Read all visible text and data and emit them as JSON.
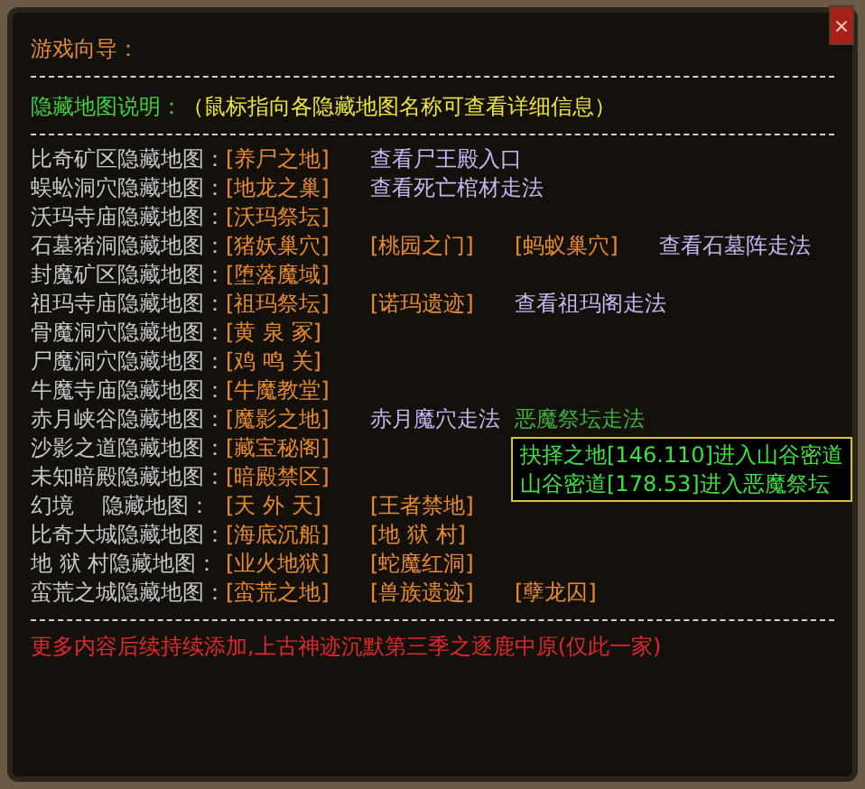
{
  "title": "游戏向导：",
  "close_button": "×",
  "legend": {
    "label": "隐藏地图说明：",
    "hint": "（鼠标指向各隐藏地图名称可查看详细信息）"
  },
  "rows": [
    {
      "label": "比奇矿区隐藏地图：",
      "items": [
        {
          "kind": "map",
          "text": "[养尸之地]",
          "hovered": false
        },
        {
          "kind": "guide",
          "text": "查看尸王殿入口",
          "hovered": false
        }
      ]
    },
    {
      "label": "蜈蚣洞穴隐藏地图：",
      "items": [
        {
          "kind": "map",
          "text": "[地龙之巢]",
          "hovered": false
        },
        {
          "kind": "guide",
          "text": "查看死亡棺材走法",
          "hovered": false
        }
      ]
    },
    {
      "label": "沃玛寺庙隐藏地图：",
      "items": [
        {
          "kind": "map",
          "text": "[沃玛祭坛]",
          "hovered": false
        }
      ]
    },
    {
      "label": "石墓猪洞隐藏地图：",
      "items": [
        {
          "kind": "map",
          "text": "[猪妖巢穴]",
          "hovered": false
        },
        {
          "kind": "map",
          "text": "[桃园之门]",
          "hovered": false
        },
        {
          "kind": "map",
          "text": "[蚂蚁巢穴]",
          "hovered": false
        },
        {
          "kind": "guide",
          "text": "查看石墓阵走法",
          "hovered": false
        }
      ]
    },
    {
      "label": "封魔矿区隐藏地图：",
      "items": [
        {
          "kind": "map",
          "text": "[堕落魔域]",
          "hovered": false
        }
      ]
    },
    {
      "label": "祖玛寺庙隐藏地图：",
      "items": [
        {
          "kind": "map",
          "text": "[祖玛祭坛]",
          "hovered": false
        },
        {
          "kind": "map",
          "text": "[诺玛遗迹]",
          "hovered": false
        },
        {
          "kind": "guide",
          "text": "查看祖玛阁走法",
          "hovered": false
        }
      ]
    },
    {
      "label": "骨魔洞穴隐藏地图：",
      "items": [
        {
          "kind": "map",
          "text": "[黄 泉 冢]",
          "hovered": false
        }
      ]
    },
    {
      "label": "尸魔洞穴隐藏地图：",
      "items": [
        {
          "kind": "map",
          "text": "[鸡 鸣 关]",
          "hovered": false
        }
      ]
    },
    {
      "label": "牛魔寺庙隐藏地图：",
      "items": [
        {
          "kind": "map",
          "text": "[牛魔教堂]",
          "hovered": false
        }
      ]
    },
    {
      "label": "赤月峡谷隐藏地图：",
      "items": [
        {
          "kind": "map",
          "text": "[魔影之地]",
          "hovered": false
        },
        {
          "kind": "guide",
          "text": "赤月魔穴走法",
          "hovered": false
        },
        {
          "kind": "guide",
          "text": "恶魔祭坛走法",
          "hovered": true
        }
      ]
    },
    {
      "label": "沙影之道隐藏地图：",
      "items": [
        {
          "kind": "map",
          "text": "[藏宝秘阁]",
          "hovered": false
        }
      ]
    },
    {
      "label": "未知暗殿隐藏地图：",
      "items": [
        {
          "kind": "map",
          "text": "[暗殿禁区]",
          "hovered": false
        }
      ]
    },
    {
      "label": "幻境    隐藏地图：",
      "items": [
        {
          "kind": "map",
          "text": "[天 外 天]",
          "hovered": false
        },
        {
          "kind": "map",
          "text": "[王者禁地]",
          "hovered": false
        }
      ]
    },
    {
      "label": "比奇大城隐藏地图：",
      "items": [
        {
          "kind": "map",
          "text": "[海底沉船]",
          "hovered": false
        },
        {
          "kind": "map",
          "text": "[地 狱 村]",
          "hovered": false
        }
      ]
    },
    {
      "label": "地 狱 村隐藏地图：",
      "items": [
        {
          "kind": "map",
          "text": "[业火地狱]",
          "hovered": false
        },
        {
          "kind": "map",
          "text": "[蛇魔红洞]",
          "hovered": false
        }
      ]
    },
    {
      "label": "蛮荒之城隐藏地图：",
      "items": [
        {
          "kind": "map",
          "text": "[蛮荒之地]",
          "hovered": false
        },
        {
          "kind": "map",
          "text": "[兽族遗迹]",
          "hovered": false
        },
        {
          "kind": "map",
          "text": "[孽龙囚]",
          "hovered": false
        }
      ]
    }
  ],
  "tooltip": {
    "lines": [
      "抉择之地[146.110]进入山谷密道",
      "山谷密道[178.53]进入恶魔祭坛"
    ]
  },
  "footer": "更多内容后续持续添加,上古神迹沉默第三季之逐鹿中原(仅此一家)"
}
